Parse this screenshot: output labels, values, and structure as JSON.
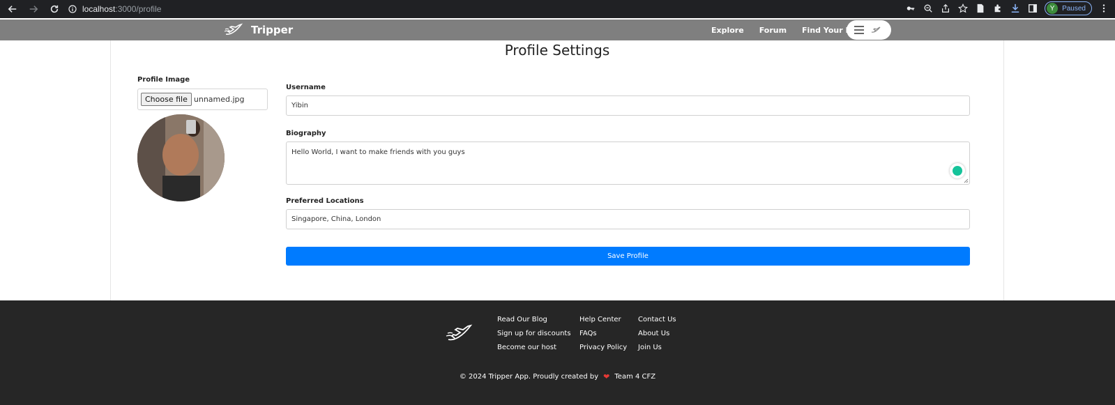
{
  "browser": {
    "url_host": "localhost",
    "url_path": ":3000/profile",
    "profile_initial": "Y",
    "profile_status": "Paused"
  },
  "site": {
    "brand_name": "Tripper",
    "nav": [
      "Explore",
      "Forum",
      "Find Your Host"
    ]
  },
  "page": {
    "title": "Profile Settings",
    "profile_image_label": "Profile Image",
    "choose_file_label": "Choose file",
    "file_name": "unnamed.jpg",
    "username_label": "Username",
    "username_value": "Yibin",
    "biography_label": "Biography",
    "biography_value": "Hello World, I want to make friends with you guys",
    "locations_label": "Preferred Locations",
    "locations_value": "Singapore, China, London",
    "save_label": "Save Profile"
  },
  "footer": {
    "col1": [
      "Read Our Blog",
      "Sign up for discounts",
      "Become our host"
    ],
    "col2": [
      "Help Center",
      "FAQs",
      "Privacy Policy"
    ],
    "col3": [
      "Contact Us",
      "About Us",
      "Join Us"
    ],
    "copyright_pre": "© 2024 Tripper App. Proudly created by",
    "copyright_post": "Team 4 CFZ"
  },
  "colors": {
    "primary": "#007bff",
    "header_bg": "#7f7f7f",
    "footer_bg": "#262626"
  }
}
